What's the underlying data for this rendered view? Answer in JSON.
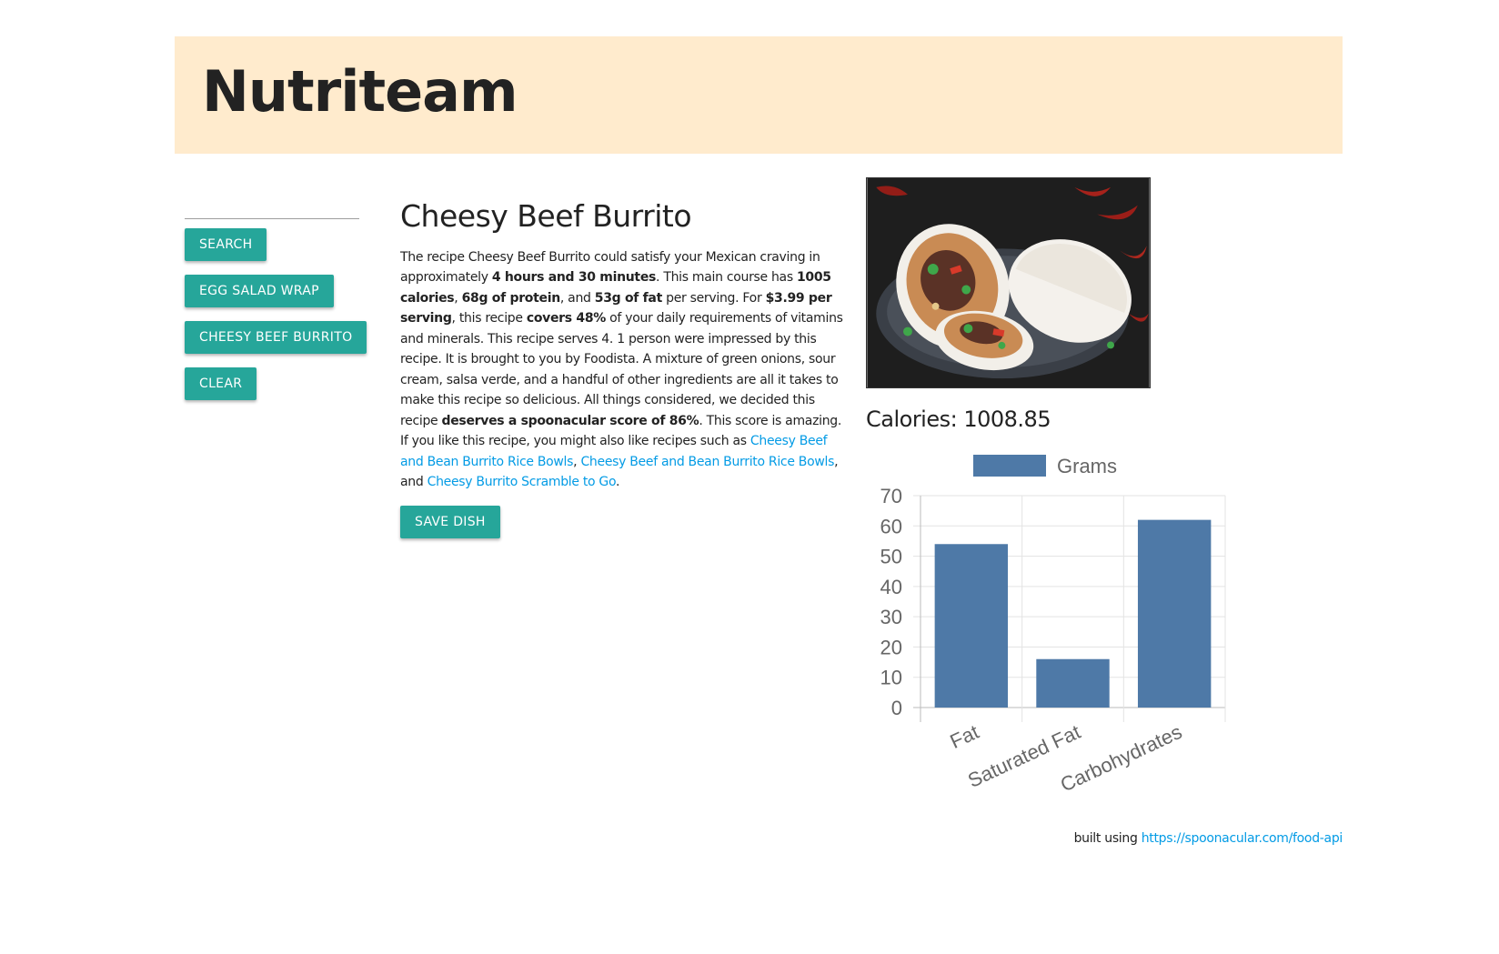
{
  "header": {
    "brand": "Nutriteam",
    "background": "#ffebcd"
  },
  "sidebar": {
    "buttons": [
      "SEARCH",
      "EGG SALAD WRAP",
      "CHEESY BEEF BURRITO",
      "CLEAR"
    ]
  },
  "recipe": {
    "title": "Cheesy Beef Burrito",
    "summary": {
      "s1": "The recipe Cheesy Beef Burrito could satisfy your Mexican craving in approximately ",
      "b1": "4 hours and 30 minutes",
      "s2": ". This main course has ",
      "b2": "1005 calories",
      "s3": ", ",
      "b3": "68g of protein",
      "s4": ", and ",
      "b4": "53g of fat",
      "s5": " per serving. For ",
      "b5": "$3.99 per serving",
      "s6": ", this recipe ",
      "b6": "covers 48%",
      "s7": " of your daily requirements of vitamins and minerals. This recipe serves 4. 1 person were impressed by this recipe. It is brought to you by Foodista. A mixture of green onions, sour cream, salsa verde, and a handful of other ingredients are all it takes to make this recipe so delicious. All things considered, we decided this recipe ",
      "b7": "deserves a spoonacular score of 86%",
      "s8": ". This score is amazing. If you like this recipe, you might also like recipes such as ",
      "link1": "Cheesy Beef and Bean Burrito Rice Bowls",
      "s9": ", ",
      "link2": "Cheesy Beef and Bean Burrito Rice Bowls",
      "s10": ", and ",
      "link3": "Cheesy Burrito Scramble to Go",
      "s11": "."
    },
    "save_label": "SAVE DISH",
    "calories": "Calories: 1008.85"
  },
  "chart_data": {
    "type": "bar",
    "categories": [
      "Fat",
      "Saturated Fat",
      "Carbohydrates"
    ],
    "series": [
      {
        "name": "Grams",
        "values": [
          54,
          16,
          62
        ]
      }
    ],
    "ylim": [
      0,
      70
    ],
    "yticks": [
      0,
      10,
      20,
      30,
      40,
      50,
      60,
      70
    ],
    "legend": "top",
    "grid": true,
    "bar_color": "#4e79a7"
  },
  "footer": {
    "text": "built using ",
    "link": "https://spoonacular.com/food-api"
  },
  "colors": {
    "accent": "#26a69a",
    "link": "#039be5"
  }
}
